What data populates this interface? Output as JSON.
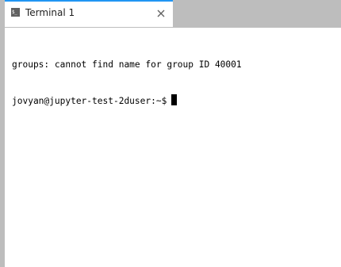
{
  "tab": {
    "title": "Terminal 1",
    "icon": "terminal-icon",
    "icon_glyph": "$_",
    "close_icon": "close-icon"
  },
  "terminal": {
    "lines": [
      "groups: cannot find name for group ID 40001"
    ],
    "prompt": "jovyan@jupyter-test-2duser:~$"
  },
  "colors": {
    "accent": "#2196f3",
    "chrome": "#bdbdbd",
    "background": "#ffffff",
    "text": "#000000"
  }
}
